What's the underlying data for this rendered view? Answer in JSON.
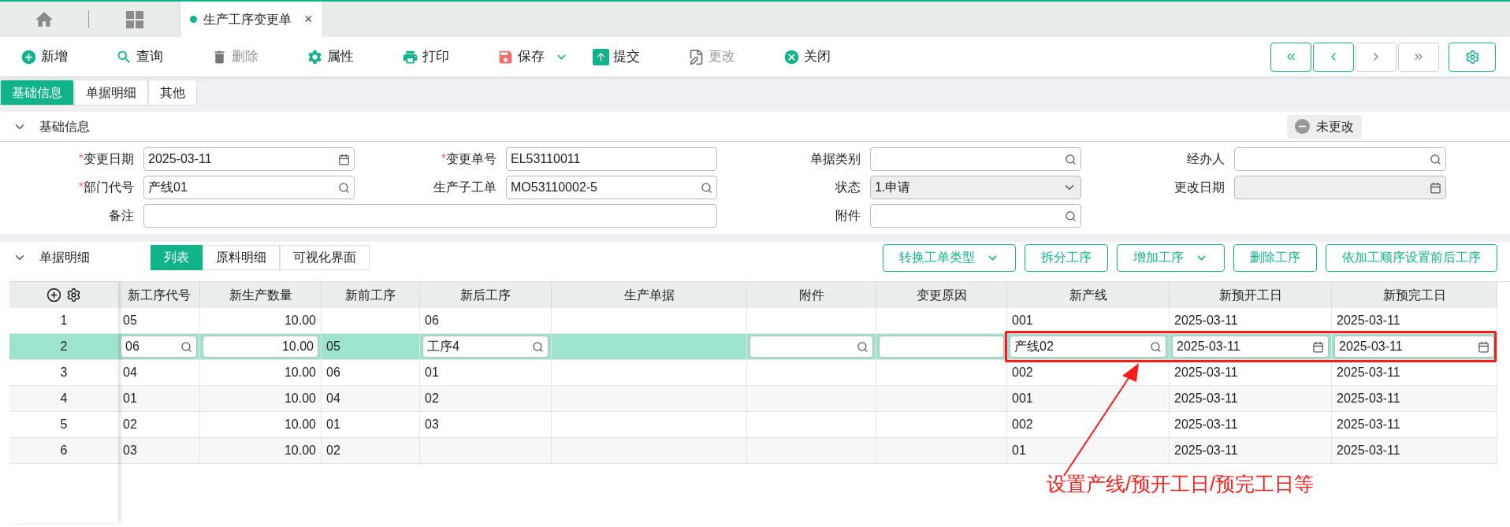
{
  "tab_bar": {
    "tabs": [
      {
        "label": "生产工序变更单",
        "selected": true,
        "close": "×"
      }
    ]
  },
  "toolbar": [
    {
      "label": "新增",
      "disabled": false
    },
    {
      "label": "查询",
      "disabled": false
    },
    {
      "label": "删除",
      "disabled": true
    },
    {
      "label": "属性",
      "disabled": false
    },
    {
      "label": "打印",
      "disabled": false
    },
    {
      "label": "保存",
      "disabled": false,
      "dropdown": true
    },
    {
      "label": "提交",
      "disabled": false
    },
    {
      "label": "更改",
      "disabled": true
    },
    {
      "label": "关闭",
      "disabled": false
    }
  ],
  "pager": [
    {
      "disabled": false
    },
    {
      "disabled": false
    },
    {
      "disabled": true
    },
    {
      "disabled": true
    }
  ],
  "form_tabs": [
    {
      "label": "基础信息",
      "selected": true
    },
    {
      "label": "单据明细",
      "selected": false
    },
    {
      "label": "其他",
      "selected": false
    }
  ],
  "basic_section": {
    "title": "基础信息",
    "expanded": true,
    "status": "未更改",
    "rows": [
      [
        {
          "label": "变更日期",
          "required_mark": "*",
          "kind": "date",
          "value": "2025-03-11",
          "disabled": false
        },
        {
          "label": "变更单号",
          "required_mark": "*",
          "kind": "text",
          "value": "EL53110011",
          "disabled": false
        },
        {
          "label": "单据类别",
          "kind": "lookup",
          "disabled": false
        },
        {
          "label": "经办人",
          "kind": "lookup",
          "disabled": false
        }
      ],
      [
        {
          "label": "部门代号",
          "required_mark": "*",
          "kind": "lookup",
          "value": "产线01",
          "disabled": false
        },
        {
          "label": "生产子工单",
          "kind": "lookup",
          "value": "MO53110002-5",
          "disabled": false
        },
        {
          "label": "状态",
          "kind": "select",
          "value": "1.申请",
          "disabled": false
        },
        {
          "label": "更改日期",
          "kind": "date",
          "disabled": true
        }
      ],
      [
        {
          "label": "备注",
          "kind": "text",
          "disabled": false
        },
        "",
        {
          "label": "附件",
          "kind": "lookup",
          "disabled": false
        }
      ]
    ]
  },
  "detail_section": {
    "title": "单据明细",
    "expanded": true,
    "view_tabs": [
      {
        "label": "列表",
        "selected": true
      },
      {
        "label": "原料明细",
        "selected": false
      },
      {
        "label": "可视化界面",
        "selected": false
      }
    ],
    "actions": [
      {
        "label": "转换工单类型",
        "dropdown": true
      },
      {
        "label": "拆分工序",
        "dropdown": false
      },
      {
        "label": "增加工序",
        "dropdown": true
      },
      {
        "label": "删除工序",
        "dropdown": false
      },
      {
        "label": "依加工顺序设置前后工序",
        "dropdown": false
      }
    ],
    "table": {
      "columns": [
        {
          "label": "新工序代号",
          "kind": "lookup"
        },
        {
          "label": "新生产数量",
          "kind": "number"
        },
        {
          "label": "新前工序",
          "kind": "plain"
        },
        {
          "label": "新后工序",
          "kind": "lookup"
        },
        {
          "label": "生产单据",
          "kind": "plain"
        },
        {
          "label": "附件",
          "kind": "lookup"
        },
        {
          "label": "变更原因",
          "kind": "input"
        },
        {
          "label": "新产线",
          "kind": "lookup"
        },
        {
          "label": "新预开工日",
          "kind": "date"
        },
        {
          "label": "新预完工日",
          "kind": "date"
        }
      ],
      "rows": [
        {
          "index": "1",
          "selected": false,
          "cells": [
            "05",
            "10.00",
            null,
            "06",
            null,
            null,
            null,
            "001",
            "2025-03-11",
            "2025-03-11"
          ]
        },
        {
          "index": "2",
          "selected": true,
          "cells": [
            "06",
            "10.00",
            "05",
            "工序4",
            null,
            null,
            null,
            "产线02",
            "2025-03-11",
            "2025-03-11"
          ]
        },
        {
          "index": "3",
          "selected": false,
          "cells": [
            "04",
            "10.00",
            "06",
            "01",
            null,
            null,
            null,
            "002",
            "2025-03-11",
            "2025-03-11"
          ]
        },
        {
          "index": "4",
          "selected": false,
          "cells": [
            "01",
            "10.00",
            "04",
            "02",
            null,
            null,
            null,
            "001",
            "2025-03-11",
            "2025-03-11"
          ]
        },
        {
          "index": "5",
          "selected": false,
          "cells": [
            "02",
            "10.00",
            "01",
            "03",
            null,
            null,
            null,
            "002",
            "2025-03-11",
            "2025-03-11"
          ]
        },
        {
          "index": "6",
          "selected": false,
          "cells": [
            "03",
            "10.00",
            "02",
            null,
            null,
            null,
            null,
            "01",
            "2025-03-11",
            "2025-03-11"
          ]
        }
      ]
    }
  },
  "annotation": {
    "text": "设置产线/预开工日/预完工日等"
  }
}
